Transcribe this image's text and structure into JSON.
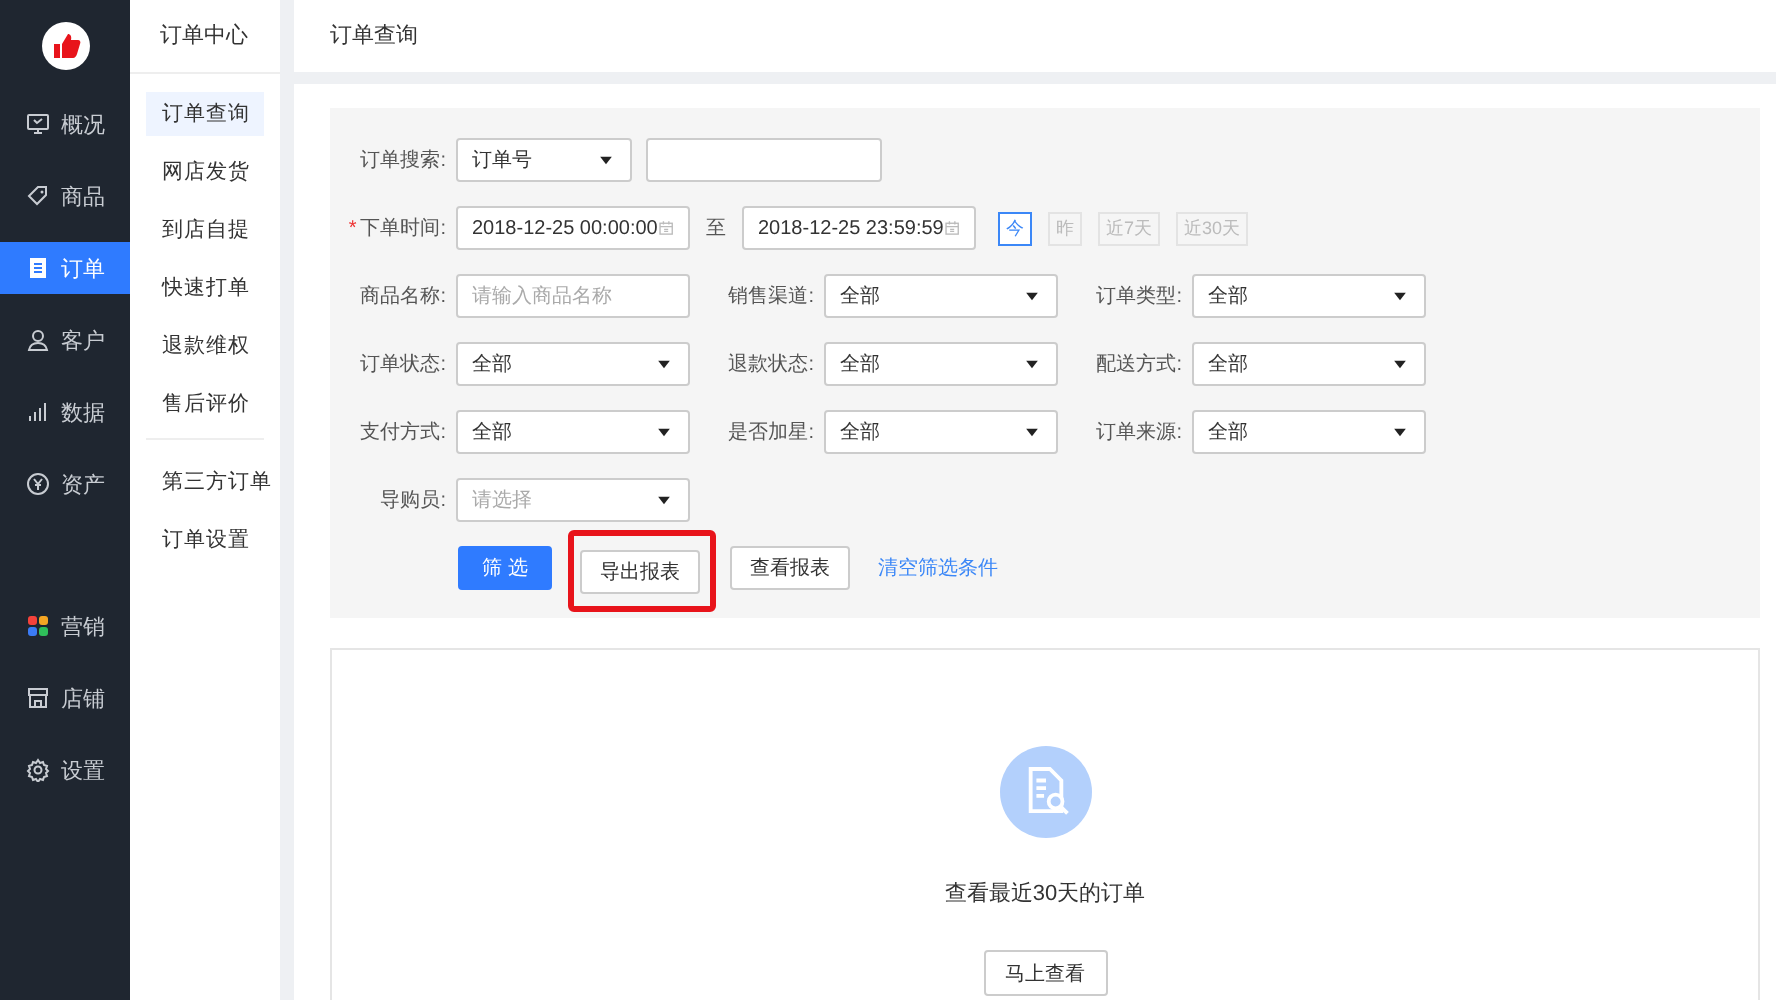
{
  "nav": {
    "groups": [
      [
        {
          "label": "概况",
          "selected": false
        },
        {
          "label": "商品",
          "selected": false
        },
        {
          "label": "订单",
          "selected": true
        },
        {
          "label": "客户",
          "selected": false
        },
        {
          "label": "数据",
          "selected": false
        },
        {
          "label": "资产",
          "selected": false
        }
      ],
      [
        {
          "label": "营销",
          "selected": false
        },
        {
          "label": "店铺",
          "selected": false
        },
        {
          "label": "设置",
          "selected": false
        }
      ]
    ]
  },
  "subnav": {
    "title": "订单中心",
    "groups": [
      [
        {
          "label": "订单查询",
          "selected": true
        },
        {
          "label": "网店发货",
          "selected": false
        },
        {
          "label": "到店自提",
          "selected": false
        },
        {
          "label": "快速打单",
          "selected": false
        },
        {
          "label": "退款维权",
          "selected": false
        },
        {
          "label": "售后评价",
          "selected": false
        }
      ],
      [
        {
          "label": "第三方订单",
          "selected": false
        },
        {
          "label": "订单设置",
          "selected": false
        }
      ]
    ]
  },
  "page_title": "订单查询",
  "filters": {
    "search": {
      "label": "订单搜索:",
      "select": "订单号"
    },
    "time": {
      "required_mark": "*",
      "label": "下单时间:",
      "start": "2018-12-25 00:00:00",
      "separator": "至",
      "end": "2018-12-25 23:59:59",
      "quick": [
        {
          "label": "今",
          "selected": true
        },
        {
          "label": "昨",
          "selected": false
        },
        {
          "label": "近7天",
          "selected": false
        },
        {
          "label": "近30天",
          "selected": false
        }
      ]
    },
    "fields": [
      {
        "label": "商品名称:",
        "kind": "text",
        "placeholder": "请输入商品名称"
      },
      {
        "label": "销售渠道:",
        "kind": "select",
        "value": "全部"
      },
      {
        "label": "订单类型:",
        "kind": "select",
        "value": "全部"
      },
      {
        "label": "订单状态:",
        "kind": "select",
        "value": "全部"
      },
      {
        "label": "退款状态:",
        "kind": "select",
        "value": "全部"
      },
      {
        "label": "配送方式:",
        "kind": "select",
        "value": "全部"
      },
      {
        "label": "支付方式:",
        "kind": "select",
        "value": "全部"
      },
      {
        "label": "是否加星:",
        "kind": "select",
        "value": "全部"
      },
      {
        "label": "订单来源:",
        "kind": "select",
        "value": "全部"
      },
      {
        "label": "导购员:",
        "kind": "select",
        "placeholder": "请选择"
      }
    ],
    "actions": [
      {
        "label": "筛 选",
        "kind": "primary",
        "highlighted": false
      },
      {
        "label": "导出报表",
        "kind": "default",
        "highlighted": true
      },
      {
        "label": "查看报表",
        "kind": "default",
        "highlighted": false
      },
      {
        "label": "清空筛选条件",
        "kind": "link",
        "highlighted": false
      }
    ]
  },
  "empty": {
    "message": "查看最近30天的订单",
    "button": "马上查看"
  }
}
